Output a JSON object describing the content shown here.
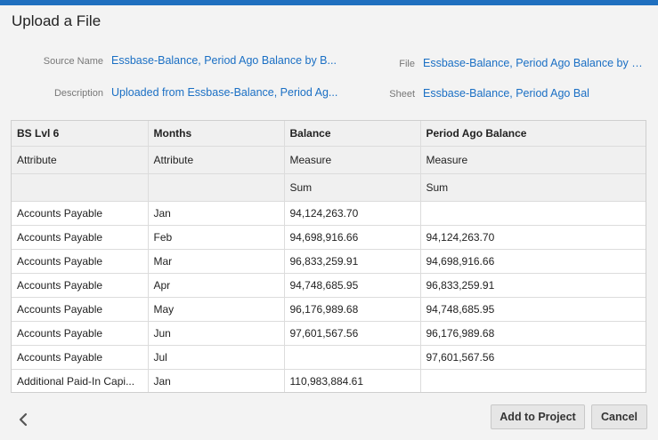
{
  "dialog": {
    "title": "Upload a File"
  },
  "meta": {
    "source_name_label": "Source Name",
    "source_name_value": "Essbase-Balance, Period Ago Balance by B...",
    "description_label": "Description",
    "description_value": "Uploaded from Essbase-Balance, Period Ag...",
    "file_label": "File",
    "file_value": "Essbase-Balance, Period Ago Balance by B...",
    "sheet_label": "Sheet",
    "sheet_value": "Essbase-Balance, Period Ago Bal"
  },
  "table": {
    "columns": [
      "BS Lvl 6",
      "Months",
      "Balance",
      "Period Ago Balance"
    ],
    "types": [
      "Attribute",
      "Attribute",
      "Measure",
      "Measure"
    ],
    "aggregations": [
      "",
      "",
      "Sum",
      "Sum"
    ],
    "rows": [
      [
        "Accounts Payable",
        "Jan",
        "94,124,263.70",
        ""
      ],
      [
        "Accounts Payable",
        "Feb",
        "94,698,916.66",
        "94,124,263.70"
      ],
      [
        "Accounts Payable",
        "Mar",
        "96,833,259.91",
        "94,698,916.66"
      ],
      [
        "Accounts Payable",
        "Apr",
        "94,748,685.95",
        "96,833,259.91"
      ],
      [
        "Accounts Payable",
        "May",
        "96,176,989.68",
        "94,748,685.95"
      ],
      [
        "Accounts Payable",
        "Jun",
        "97,601,567.56",
        "96,176,989.68"
      ],
      [
        "Accounts Payable",
        "Jul",
        "",
        "97,601,567.56"
      ],
      [
        "Additional Paid-In Capi...",
        "Jan",
        "110,983,884.61",
        ""
      ]
    ]
  },
  "footer": {
    "back_icon": "chevron-left-icon",
    "add_label": "Add to Project",
    "cancel_label": "Cancel"
  },
  "colors": {
    "accent": "#1f6fbf",
    "link": "#1a6fc4",
    "background": "#f3f3f3"
  }
}
